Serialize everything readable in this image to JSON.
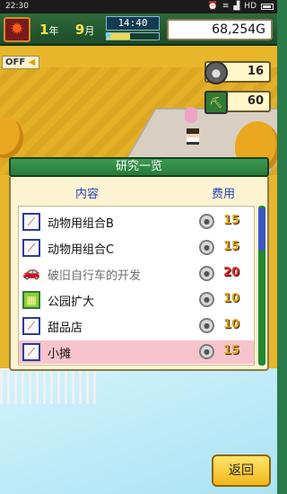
{
  "statusbar": {
    "time": "22:30",
    "network": "HD"
  },
  "hud": {
    "year": "1",
    "year_unit": "年",
    "month": "9",
    "month_unit": "月",
    "clock": "14:40",
    "day_progress": 0.45,
    "money": "68,254G",
    "off_label": "OFF",
    "research_points": "16",
    "workers": "60"
  },
  "dialog": {
    "title": "研究一览",
    "col_content": "内容",
    "col_cost": "费用",
    "items": [
      {
        "icon": "slide-icon",
        "name": "动物用组合B",
        "cost": "15",
        "cost_color": "gold",
        "enabled": true,
        "selected": false
      },
      {
        "icon": "slide-icon",
        "name": "动物用组合C",
        "cost": "15",
        "cost_color": "gold",
        "enabled": true,
        "selected": false
      },
      {
        "icon": "car-icon",
        "name": "破旧自行车的开发",
        "cost": "20",
        "cost_color": "red",
        "enabled": false,
        "selected": false
      },
      {
        "icon": "park-icon",
        "name": "公园扩大",
        "cost": "10",
        "cost_color": "gold",
        "enabled": true,
        "selected": false
      },
      {
        "icon": "slide-icon",
        "name": "甜品店",
        "cost": "10",
        "cost_color": "gold",
        "enabled": true,
        "selected": false
      },
      {
        "icon": "slide-icon",
        "name": "小摊",
        "cost": "15",
        "cost_color": "gold",
        "enabled": true,
        "selected": true
      }
    ]
  },
  "back_button": "返回",
  "colors": {
    "title_green": "#267a3a",
    "header_blue": "#2a42b8",
    "selected_row": "#f7c3cc",
    "cost_gold": "#e1a51d",
    "cost_red": "#e2302a"
  }
}
